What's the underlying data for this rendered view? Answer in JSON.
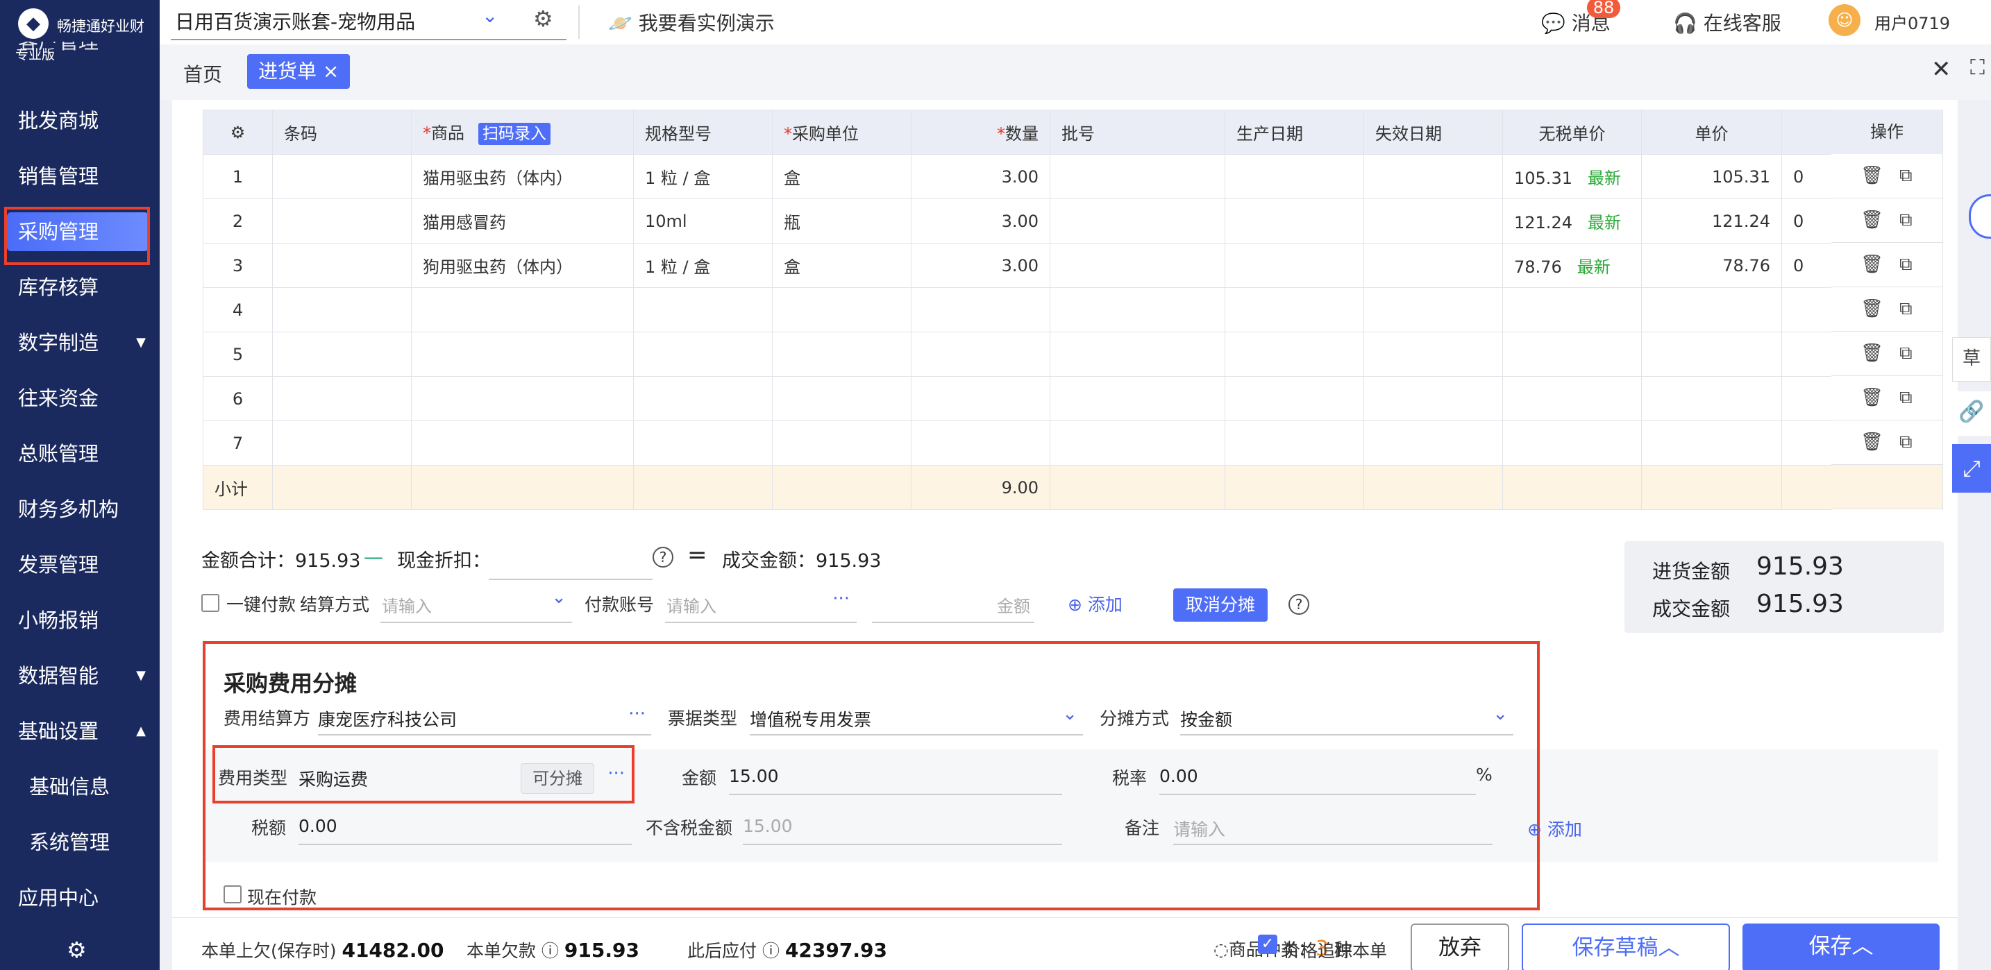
{
  "app": {
    "name": "畅捷通好业财",
    "edition": "专业版"
  },
  "topbar": {
    "account": "日用百货演示账套-宠物用品",
    "demo_link": "我要看实例演示",
    "messages_label": "消息",
    "messages_count": "88",
    "service_label": "在线客服",
    "user": "用户0719"
  },
  "sidebar": {
    "items": [
      {
        "label": "批发商城"
      },
      {
        "label": "销售管理"
      },
      {
        "label": "采购管理"
      },
      {
        "label": "库存核算"
      },
      {
        "label": "数字制造"
      },
      {
        "label": "往来资金"
      },
      {
        "label": "总账管理"
      },
      {
        "label": "财务多机构"
      },
      {
        "label": "发票管理"
      },
      {
        "label": "小畅报销"
      },
      {
        "label": "数据智能"
      },
      {
        "label": "基础设置"
      },
      {
        "label": "基础信息"
      },
      {
        "label": "系统管理"
      },
      {
        "label": "应用中心"
      }
    ],
    "cut_top_label": "客户管理"
  },
  "tabs": {
    "home": "首页",
    "current": "进货单"
  },
  "table": {
    "headers": {
      "barcode": "条码",
      "product": "商品",
      "scan": "扫码录入",
      "spec": "规格型号",
      "unit": "采购单位",
      "qty": "数量",
      "batch": "批号",
      "prod_date": "生产日期",
      "exp_date": "失效日期",
      "pretax_price": "无税单价",
      "price": "单价",
      "ops": "操作"
    },
    "rows": [
      {
        "no": "1",
        "product": "猫用驱虫药（体内）",
        "spec": "1 粒 / 盒",
        "unit": "盒",
        "qty": "3.00",
        "pretax": "105.31",
        "tag": "最新",
        "price": "105.31",
        "extra": "0"
      },
      {
        "no": "2",
        "product": "猫用感冒药",
        "spec": "10ml",
        "unit": "瓶",
        "qty": "3.00",
        "pretax": "121.24",
        "tag": "最新",
        "price": "121.24",
        "extra": "0"
      },
      {
        "no": "3",
        "product": "狗用驱虫药（体内）",
        "spec": "1 粒 / 盒",
        "unit": "盒",
        "qty": "3.00",
        "pretax": "78.76",
        "tag": "最新",
        "price": "78.76",
        "extra": "0"
      },
      {
        "no": "4"
      },
      {
        "no": "5"
      },
      {
        "no": "6"
      },
      {
        "no": "7"
      }
    ],
    "subtotal_label": "小计",
    "subtotal_qty": "9.00"
  },
  "totals": {
    "amount_label": "金额合计：",
    "amount": "915.93",
    "discount_label": "现金折扣：",
    "deal_label": "成交金额：",
    "deal": "915.93",
    "one_click_pay": "一键付款",
    "settle_label": "结算方式",
    "settle_placeholder": "请输入",
    "account_label": "付款账号",
    "account_placeholder": "请输入",
    "money_placeholder": "金额",
    "add": "添加",
    "cancel_alloc": "取消分摊"
  },
  "summary": {
    "purchase_label": "进货金额",
    "purchase": "915.93",
    "deal_label": "成交金额",
    "deal": "915.93"
  },
  "allocation": {
    "title": "采购费用分摊",
    "payer_label": "费用结算方",
    "payer": "康宠医疗科技公司",
    "invoice_label": "票据类型",
    "invoice": "增值税专用发票",
    "method_label": "分摊方式",
    "method": "按金额",
    "type_label": "费用类型",
    "type": "采购运费",
    "allocable": "可分摊",
    "amount_label": "金额",
    "amount": "15.00",
    "tax_rate_label": "税率",
    "tax_rate": "0.00",
    "percent": "%",
    "tax_label": "税额",
    "tax": "0.00",
    "net_label": "不含税金额",
    "net": "15.00",
    "note_label": "备注",
    "note_placeholder": "请输入",
    "add": "添加",
    "pay_now": "现在付款"
  },
  "footer": {
    "prev_due_label": "本单上欠(保存时)",
    "prev_due": "41482.00",
    "this_due_label": "本单欠款",
    "this_due": "915.93",
    "after_label": "此后应付",
    "after": "42397.93",
    "goods_label": "商品种类：",
    "goods_count": "3",
    "goods_unit": "种",
    "trace_label": "价格追踪本单",
    "discard": "放弃",
    "save_draft": "保存草稿",
    "save": "保存"
  },
  "side": {
    "draft": "草"
  },
  "colors": {
    "primary": "#4f6ef7",
    "sidebar": "#1b2a5e",
    "highlight": "#e8402c",
    "green": "#2eab3a"
  }
}
